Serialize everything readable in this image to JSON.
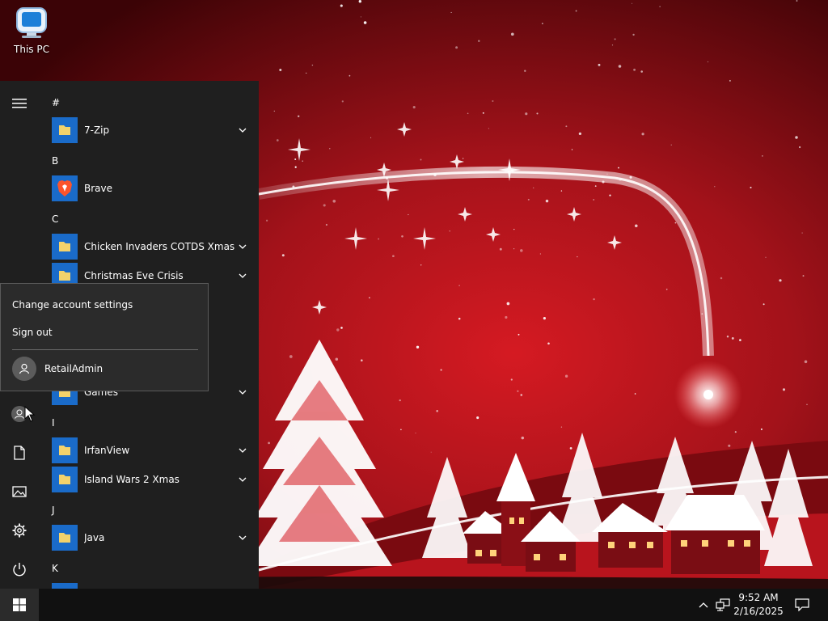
{
  "desktop": {
    "icons": [
      {
        "label": "This PC",
        "icon": "this-pc-icon"
      }
    ]
  },
  "start_menu": {
    "rail": {
      "hamburger": "hamburger-menu-icon",
      "account": "user-avatar-icon",
      "documents": "document-icon",
      "pictures": "pictures-icon",
      "settings": "gear-icon",
      "power": "power-icon"
    },
    "groups": [
      "#",
      "B",
      "C",
      "I",
      "J",
      "K"
    ],
    "apps": [
      {
        "name": "7-Zip",
        "expandable": true,
        "icon": "folder-icon"
      },
      {
        "name": "Brave",
        "expandable": false,
        "icon": "brave-icon"
      },
      {
        "name": "Chicken Invaders COTDS Xmas",
        "expandable": true,
        "icon": "folder-icon"
      },
      {
        "name": "Christmas Eve Crisis",
        "expandable": true,
        "icon": "folder-icon"
      },
      {
        "name": "Games",
        "expandable": true,
        "icon": "folder-icon"
      },
      {
        "name": "IrfanView",
        "expandable": true,
        "icon": "folder-icon"
      },
      {
        "name": "Island Wars 2 Xmas",
        "expandable": true,
        "icon": "folder-icon"
      },
      {
        "name": "Java",
        "expandable": true,
        "icon": "folder-icon"
      }
    ]
  },
  "account_flyout": {
    "change_settings": "Change account settings",
    "sign_out": "Sign out",
    "user_name": "RetailAdmin"
  },
  "taskbar": {
    "start_icon": "windows-logo-icon",
    "tray_icons": [
      "chevron-up-icon",
      "network-icon"
    ],
    "clock": {
      "time": "9:52 AM",
      "date": "2/16/2025"
    },
    "action_center_icon": "notification-icon"
  },
  "colors": {
    "start_bg": "#1f1f1f",
    "tile_blue": "#1a6bc9",
    "folder_yellow": "#f3d26b",
    "brave_orange": "#fb542b",
    "wallpaper_red": "#a3121a"
  }
}
